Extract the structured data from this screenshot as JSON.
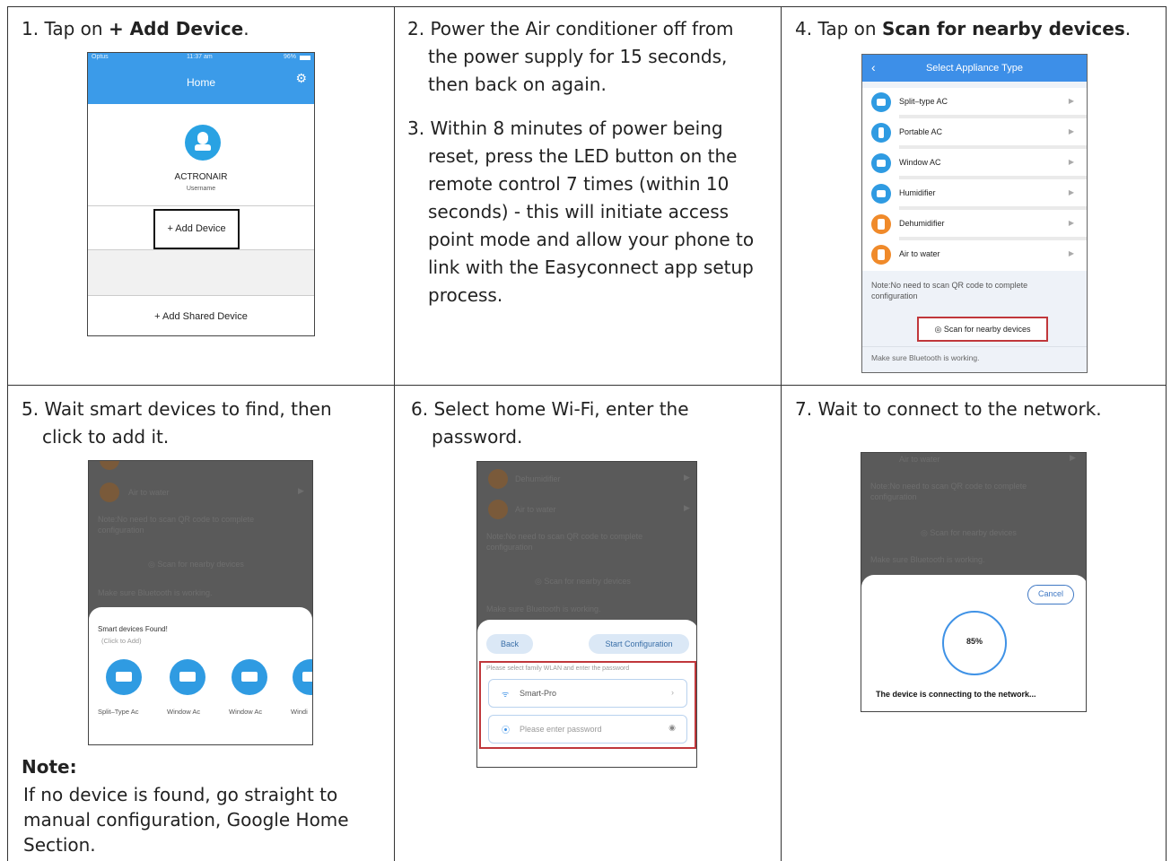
{
  "steps": {
    "s1_prefix": "1. Tap on ",
    "s1_bold": "+ Add Device",
    "s1_suffix": ".",
    "s2_line1": "2. Power the Air conditioner off from",
    "s2_line2": "the power supply for 15 seconds,",
    "s2_line3": "then back on again.",
    "s3_lines": [
      "3. Within 8 minutes of power being",
      "reset, press the LED button on the",
      "remote control 7 times (within 10",
      "seconds) - this will initiate access",
      "point mode and allow your phone to",
      "link with the Easyconnect app setup",
      "process."
    ],
    "s4_prefix": "4. Tap on ",
    "s4_bold": "Scan for nearby devices",
    "s4_suffix": ".",
    "s5_line1": "5. Wait smart devices to find, then",
    "s5_line2": "click to add it.",
    "s6_line1": "6. Select home Wi-Fi, enter the",
    "s6_line2": "password.",
    "s7_line1": "7. Wait to connect to the network."
  },
  "note": {
    "title": "Note:",
    "lines": [
      "If no device is found, go straight to",
      "manual configuration, Google Home",
      "Section."
    ]
  },
  "screen1": {
    "carrier": "Optus",
    "time": "11:37 am",
    "battery": "96%",
    "title": "Home",
    "gear_icon": "gear-icon",
    "user_name": "ACTRONAIR",
    "user_sub": "Username",
    "add_device": "+ Add Device",
    "add_shared": "+ Add Shared Device",
    "accent": "#3b9be9"
  },
  "screen4": {
    "title": "Select Appliance Type",
    "back": "‹",
    "appliances": [
      {
        "label": "Split–type AC",
        "color": "#2f9be2"
      },
      {
        "label": "Portable AC",
        "color": "#2f9be2"
      },
      {
        "label": "Window AC",
        "color": "#2f9be2"
      },
      {
        "label": "Humidifier",
        "color": "#2f9be2"
      },
      {
        "label": "Dehumidifier",
        "color": "#f08a2a"
      },
      {
        "label": "Air to water",
        "color": "#f08a2a"
      }
    ],
    "note": "Note:No need to scan QR code to complete configuration",
    "scan": "Scan for nearby devices",
    "bluetooth": "Make sure Bluetooth is working."
  },
  "screen5": {
    "bg_air": "Air to water",
    "bg_note1": "Note:No need to scan QR code to complete",
    "bg_note2": "configuration",
    "bg_scan": "Scan for nearby devices",
    "bg_bt": "Make sure Bluetooth is working.",
    "found_title": "Smart devices Found!",
    "found_sub": "(Click to Add)",
    "devices": [
      "Split–Type Ac",
      "Window Ac",
      "Window Ac",
      "Windi"
    ]
  },
  "screen6": {
    "bg_dehum": "Dehumidifier",
    "bg_air": "Air to water",
    "bg_note1": "Note:No need to scan QR code to complete",
    "bg_note2": "configuration",
    "bg_scan": "Scan for nearby devices",
    "bg_bt": "Make sure Bluetooth is working.",
    "back": "Back",
    "start": "Start Configuration",
    "prompt": "Please select family WLAN and enter the password",
    "wifi": "Smart-Pro",
    "password_placeholder": "Please enter password"
  },
  "screen7": {
    "bg_air": "Air to water",
    "bg_note1": "Note:No need to scan QR code to complete",
    "bg_note2": "configuration",
    "bg_scan": "Scan for nearby devices",
    "bg_bt": "Make sure Bluetooth is working.",
    "cancel": "Cancel",
    "progress": "85%",
    "progress_value": 0.85,
    "connecting": "The device is connecting to the network..."
  }
}
